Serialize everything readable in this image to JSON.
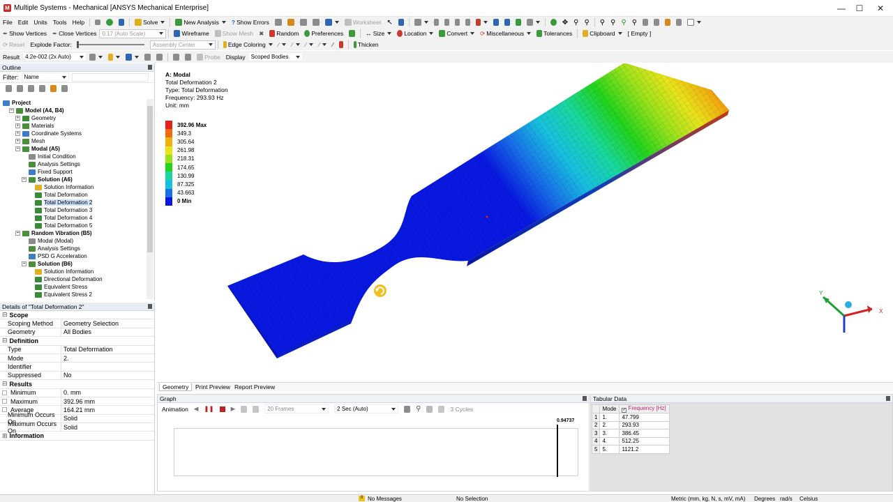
{
  "window": {
    "title": "Multiple Systems - Mechanical [ANSYS Mechanical Enterprise]",
    "app_icon": "ansys-logo-icon"
  },
  "menu": [
    "File",
    "Edit",
    "Units",
    "Tools",
    "Help"
  ],
  "toolbar1": {
    "solve": "Solve",
    "new_analysis": "New Analysis",
    "show_errors": "Show Errors",
    "worksheet": "Worksheet"
  },
  "toolbar2": {
    "show_vertices": "Show Vertices",
    "close_vertices": "Close Vertices",
    "auto_scale": "0.17 (Auto Scale)",
    "wireframe": "Wireframe",
    "show_mesh": "Show Mesh",
    "random": "Random",
    "preferences": "Preferences",
    "size": "Size",
    "location": "Location",
    "convert": "Convert",
    "miscellaneous": "Miscellaneous",
    "tolerances": "Tolerances",
    "clipboard": "Clipboard",
    "clipboard_value": "[ Empty ]"
  },
  "toolbar3": {
    "reset": "Reset",
    "explode_factor": "Explode Factor:",
    "assembly_center": "Assembly Center",
    "edge_coloring": "Edge Coloring",
    "thicken": "Thicken"
  },
  "toolbar4": {
    "result_label": "Result",
    "result_value": "4.2e-002 (2x Auto)",
    "probe": "Probe",
    "display_label": "Display",
    "display_value": "Scoped Bodies"
  },
  "outline": {
    "title": "Outline",
    "filter_label": "Filter:",
    "filter_value": "Name",
    "tree": [
      {
        "label": "Project",
        "level": 0,
        "bold": true,
        "exp": "",
        "color": "#3c7dc4"
      },
      {
        "label": "Model (A4, B4)",
        "level": 1,
        "bold": true,
        "exp": "−",
        "color": "#4c8f3a"
      },
      {
        "label": "Geometry",
        "level": 2,
        "exp": "+",
        "color": "#3a8a3a"
      },
      {
        "label": "Materials",
        "level": 2,
        "exp": "+",
        "color": "#4c8f3a"
      },
      {
        "label": "Coordinate Systems",
        "level": 2,
        "exp": "+",
        "color": "#3c7dc4"
      },
      {
        "label": "Mesh",
        "level": 2,
        "exp": "+",
        "color": "#4c8f3a"
      },
      {
        "label": "Modal (A5)",
        "level": 2,
        "bold": true,
        "exp": "−",
        "color": "#4c8f3a"
      },
      {
        "label": "Initial Condition",
        "level": 3,
        "exp": "",
        "color": "#8c8c8c"
      },
      {
        "label": "Analysis Settings",
        "level": 3,
        "exp": "",
        "color": "#4c8f3a"
      },
      {
        "label": "Fixed Support",
        "level": 3,
        "exp": "",
        "color": "#3c7dc4"
      },
      {
        "label": "Solution (A6)",
        "level": 3,
        "bold": true,
        "exp": "−",
        "color": "#4c8f3a"
      },
      {
        "label": "Solution Information",
        "level": 4,
        "exp": "",
        "color": "#e0b020"
      },
      {
        "label": "Total Deformation",
        "level": 4,
        "exp": "",
        "color": "#3a8a3a"
      },
      {
        "label": "Total Deformation 2",
        "level": 4,
        "exp": "",
        "color": "#3a8a3a",
        "sel": true
      },
      {
        "label": "Total Deformation 3",
        "level": 4,
        "exp": "",
        "color": "#3a8a3a"
      },
      {
        "label": "Total Deformation 4",
        "level": 4,
        "exp": "",
        "color": "#3a8a3a"
      },
      {
        "label": "Total Deformation 5",
        "level": 4,
        "exp": "",
        "color": "#3a8a3a"
      },
      {
        "label": "Random Vibration (B5)",
        "level": 2,
        "bold": true,
        "exp": "−",
        "color": "#4c8f3a"
      },
      {
        "label": "Modal (Modal)",
        "level": 3,
        "exp": "",
        "color": "#8c8c8c"
      },
      {
        "label": "Analysis Settings",
        "level": 3,
        "exp": "",
        "color": "#4c8f3a"
      },
      {
        "label": "PSD G Acceleration",
        "level": 3,
        "exp": "",
        "color": "#3c7dc4"
      },
      {
        "label": "Solution (B6)",
        "level": 3,
        "bold": true,
        "exp": "−",
        "color": "#4c8f3a"
      },
      {
        "label": "Solution Information",
        "level": 4,
        "exp": "",
        "color": "#e0b020"
      },
      {
        "label": "Directional Deformation",
        "level": 4,
        "exp": "",
        "color": "#3a8a3a"
      },
      {
        "label": "Equivalent Stress",
        "level": 4,
        "exp": "",
        "color": "#3a8a3a"
      },
      {
        "label": "Equivalent Stress 2",
        "level": 4,
        "exp": "",
        "color": "#3a8a3a"
      }
    ]
  },
  "details": {
    "title": "Details of \"Total Deformation 2\"",
    "rows": [
      {
        "type": "sec",
        "k": "Scope"
      },
      {
        "k": "Scoping Method",
        "v": "Geometry Selection"
      },
      {
        "k": "Geometry",
        "v": "All Bodies"
      },
      {
        "type": "sec",
        "k": "Definition"
      },
      {
        "k": "Type",
        "v": "Total Deformation"
      },
      {
        "k": "Mode",
        "v": "2."
      },
      {
        "k": "Identifier",
        "v": ""
      },
      {
        "k": "Suppressed",
        "v": "No"
      },
      {
        "type": "sec",
        "k": "Results"
      },
      {
        "k": "Minimum",
        "v": "0. mm",
        "chk": true
      },
      {
        "k": "Maximum",
        "v": "392.96 mm",
        "chk": true
      },
      {
        "k": "Average",
        "v": "164.21 mm",
        "chk": true
      },
      {
        "k": "Minimum Occurs On",
        "v": "Solid"
      },
      {
        "k": "Maximum Occurs On",
        "v": "Solid"
      },
      {
        "type": "sec",
        "k": "Information",
        "closed": true
      }
    ]
  },
  "viewport": {
    "line1": "A: Modal",
    "line2": "Total Deformation 2",
    "line3": "Type: Total Deformation",
    "line4": "Frequency: 293.93 Hz",
    "line5": "Unit: mm",
    "legend": [
      {
        "label": "392.96 Max",
        "color": "#e8201c",
        "bold": true
      },
      {
        "label": "349.3",
        "color": "#f06a10"
      },
      {
        "label": "305.64",
        "color": "#f0b010"
      },
      {
        "label": "261.98",
        "color": "#e8e41c"
      },
      {
        "label": "218.31",
        "color": "#9ae21c"
      },
      {
        "label": "174.65",
        "color": "#22d41c"
      },
      {
        "label": "130.99",
        "color": "#18d8a0"
      },
      {
        "label": "87.325",
        "color": "#18c0e0"
      },
      {
        "label": "43.663",
        "color": "#1870e8"
      },
      {
        "label": "0 Min",
        "color": "#0818e0",
        "bold": true
      }
    ],
    "axes": {
      "x": "X",
      "y": "Y"
    }
  },
  "viewtabs": [
    "Geometry",
    "Print Preview",
    "Report Preview"
  ],
  "graph": {
    "title": "Graph",
    "animation": "Animation",
    "frames": "20 Frames",
    "time": "2 Sec (Auto)",
    "cycles": "3 Cycles",
    "marker_value": "0.94737"
  },
  "tabular": {
    "title": "Tabular Data",
    "col_mode": "Mode",
    "col_freq": "Frequency [Hz]",
    "rows": [
      {
        "n": "1",
        "mode": "1.",
        "f": "47.799"
      },
      {
        "n": "2",
        "mode": "2.",
        "f": "293.93"
      },
      {
        "n": "3",
        "mode": "3.",
        "f": "386.45"
      },
      {
        "n": "4",
        "mode": "4.",
        "f": "512.25"
      },
      {
        "n": "5",
        "mode": "5.",
        "f": "1121.2"
      }
    ]
  },
  "status": {
    "messages": "No Messages",
    "messages_count": "0",
    "selection": "No Selection",
    "units": "Metric (mm, kg, N, s, mV, mA)",
    "angle": "Degrees",
    "rate": "rad/s",
    "temp": "Celsius"
  }
}
